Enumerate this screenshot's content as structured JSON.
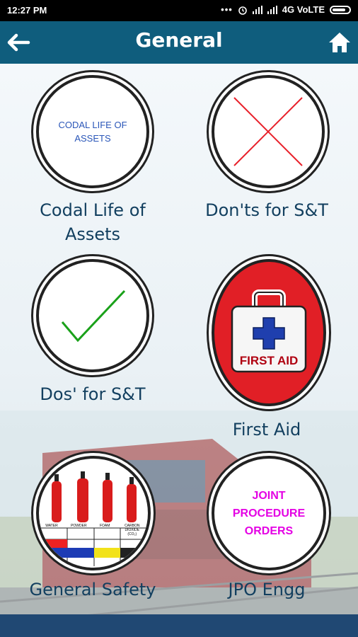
{
  "status_bar": {
    "time": "12:27 PM",
    "network": "4G VoLTE"
  },
  "app_bar": {
    "title": "General",
    "back_icon": "arrow-left-icon",
    "home_icon": "home-icon"
  },
  "items": [
    {
      "label": "Codal Life of Assets",
      "icon_text": "CODAL LIFE OF ASSETS"
    },
    {
      "label": "Don'ts for S&T",
      "icon": "red-cross-icon"
    },
    {
      "label": "Dos' for S&T",
      "icon": "green-check-icon"
    },
    {
      "label": "First Aid",
      "icon_text": "FIRST AID"
    },
    {
      "label": "General Safety",
      "icon": "fire-extinguishers-icon",
      "extinguishers": [
        "WATER",
        "POWDER",
        "FOAM",
        "CARBON DIOXIDE (CO₂)"
      ]
    },
    {
      "label": "JPO Engg",
      "icon_text": "JOINT PROCEDURE ORDERS"
    }
  ],
  "colors": {
    "app_bar": "#0f5d7d",
    "label": "#123f5f",
    "bottom_bar": "#204873"
  }
}
